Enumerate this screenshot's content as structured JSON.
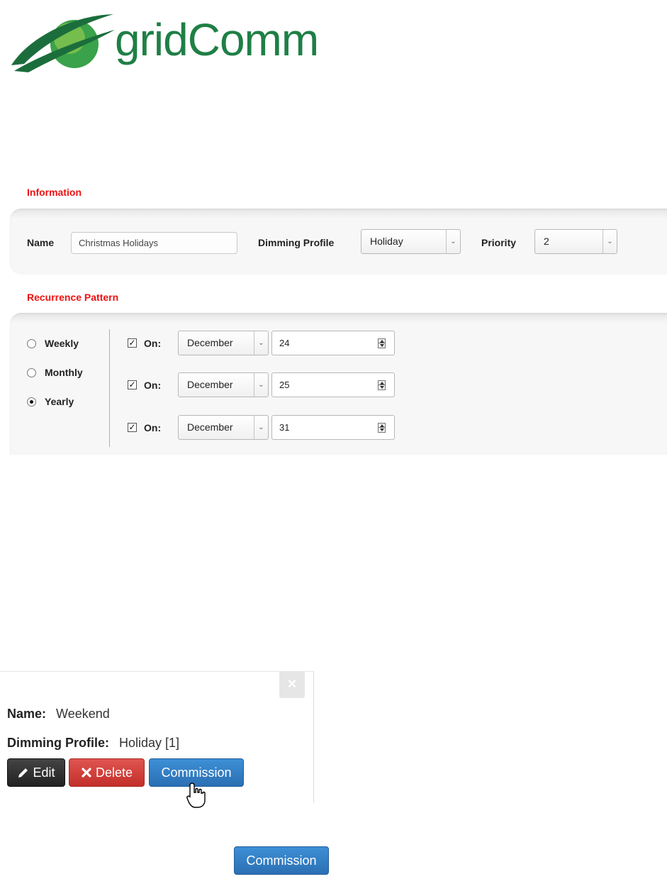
{
  "logo": {
    "text_part1": "grid",
    "text_part2": "Comm"
  },
  "information": {
    "title": "Information",
    "name_label": "Name",
    "name_value": "Christmas Holidays",
    "dimming_label": "Dimming Profile",
    "dimming_value": "Holiday",
    "priority_label": "Priority",
    "priority_value": "2"
  },
  "recurrence": {
    "title": "Recurrence Pattern",
    "options": [
      {
        "label": "Weekly",
        "selected": false
      },
      {
        "label": "Monthly",
        "selected": false
      },
      {
        "label": "Yearly",
        "selected": true
      }
    ],
    "dates": [
      {
        "checked": true,
        "on_label": "On:",
        "month": "December",
        "day": "24"
      },
      {
        "checked": true,
        "on_label": "On:",
        "month": "December",
        "day": "25"
      },
      {
        "checked": true,
        "on_label": "On:",
        "month": "December",
        "day": "31"
      }
    ]
  },
  "popover": {
    "close": "×",
    "name_label": "Name:",
    "name_value": "Weekend",
    "dimming_label": "Dimming Profile:",
    "dimming_value": "Holiday [1]",
    "edit_label": "Edit",
    "delete_label": "Delete",
    "commission_label": "Commission"
  },
  "standalone": {
    "commission_label": "Commission"
  },
  "colors": {
    "brand_green": "#1f7f46",
    "section_red": "#ee1111",
    "primary_blue": "#2b6fb3",
    "danger_red": "#c32f2a",
    "dark": "#222222"
  },
  "icons": [
    "logo-swoosh-icon",
    "radio-icon",
    "checkbox-icon",
    "dropdown-arrow-icon",
    "spinner-icon",
    "close-icon",
    "pencil-icon",
    "x-icon",
    "hand-cursor-icon"
  ]
}
